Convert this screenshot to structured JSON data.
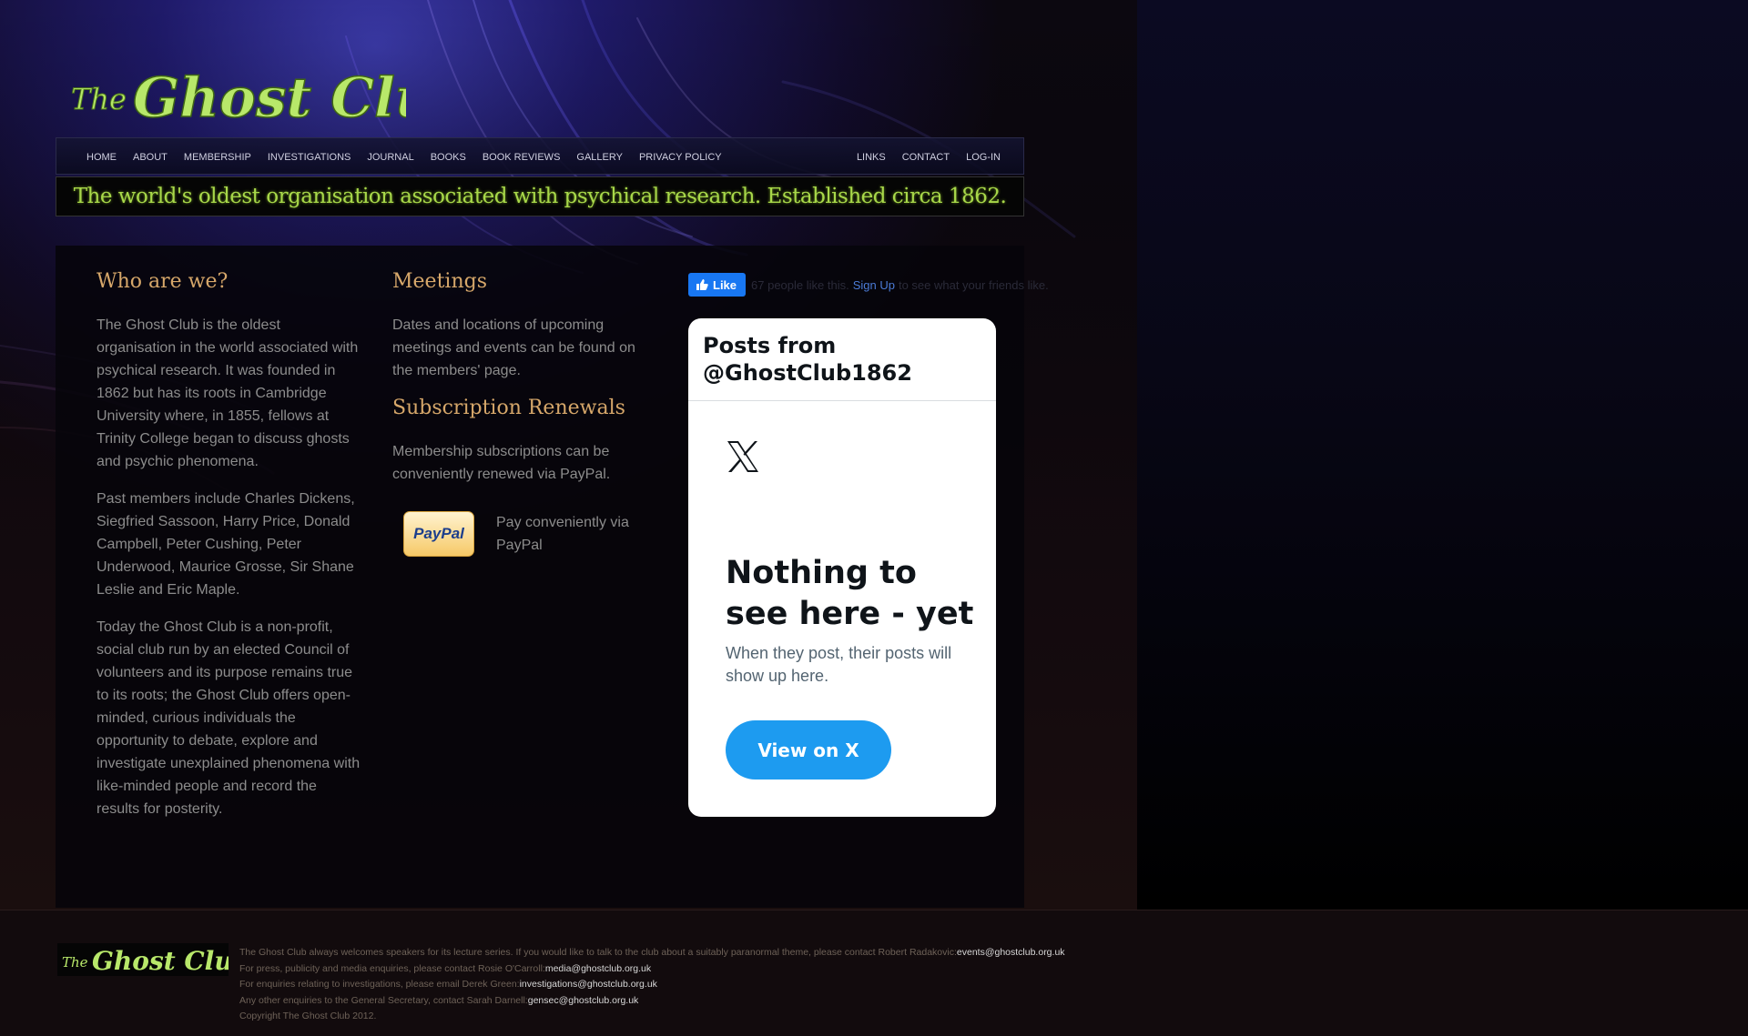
{
  "site": {
    "logo_text": "The Ghost Club",
    "tagline": "The world's oldest organisation associated with psychical research. Established circa 1862."
  },
  "nav": {
    "left": [
      "HOME",
      "ABOUT",
      "MEMBERSHIP",
      "INVESTIGATIONS",
      "JOURNAL",
      "BOOKS",
      "BOOK REVIEWS",
      "GALLERY",
      "PRIVACY POLICY"
    ],
    "right": [
      "LINKS",
      "CONTACT",
      "LOG-IN"
    ]
  },
  "who": {
    "title": "Who are we?",
    "paragraphs": [
      "The Ghost Club is the oldest organisation in the world associated with psychical research. It was founded in 1862 but has its roots in Cambridge University where, in 1855, fellows at Trinity College began to discuss ghosts and psychic phenomena.",
      "Past members include Charles Dickens, Siegfried Sassoon, Harry Price, Donald Campbell, Peter Cushing, Peter Underwood, Maurice Grosse, Sir Shane Leslie and Eric Maple.",
      "Today the Ghost Club is a non-profit, social club run by an elected Council of volunteers and its purpose remains true to its roots; the Ghost Club offers open-minded, curious individuals the opportunity to debate, explore and investigate unexplained phenomena with like-minded people and record the results for posterity."
    ]
  },
  "meetings": {
    "title": "Meetings",
    "text": "Dates and locations of upcoming meetings and events can be found on the members' page."
  },
  "subscriptions": {
    "title": "Subscription Renewals",
    "text": "Membership subscriptions can be conveniently renewed via PayPal.",
    "paypal_logo_text": "PayPal",
    "paypal_label": "Pay conveniently via PayPal"
  },
  "facebook": {
    "like_label": "Like",
    "count_text": "67 people like this.",
    "signup_label": "Sign Up",
    "rest_text": "to see what your friends like."
  },
  "x_widget": {
    "header": "Posts from @GhostClub1862",
    "empty_title": "Nothing to see here - yet",
    "empty_sub": "When they post, their posts will show up here.",
    "button_label": "View on X"
  },
  "footer": {
    "lines": [
      {
        "text": "The Ghost Club always welcomes speakers for its lecture series. If you would like to talk to the club about a suitably paranormal theme, please contact Robert Radakovic:",
        "email": "events@ghostclub.org.uk"
      },
      {
        "text": "For press, publicity and media enquiries, please contact Rosie O'Carroll:",
        "email": "media@ghostclub.org.uk"
      },
      {
        "text": "For enquiries relating to investigations, please email Derek Green:",
        "email": "investigations@ghostclub.org.uk"
      },
      {
        "text": "Any other enquiries to the General Secretary, contact Sarah Darnell:",
        "email": "gensec@ghostclub.org.uk"
      },
      {
        "text": "Copyright The Ghost Club 2012.",
        "email": ""
      }
    ]
  },
  "colors": {
    "heading": "#d6a76a",
    "body_text": "#8c8c8c",
    "tagline_green": "#a8d84a",
    "x_blue": "#1d9bf0",
    "fb_blue": "#1877f2"
  }
}
